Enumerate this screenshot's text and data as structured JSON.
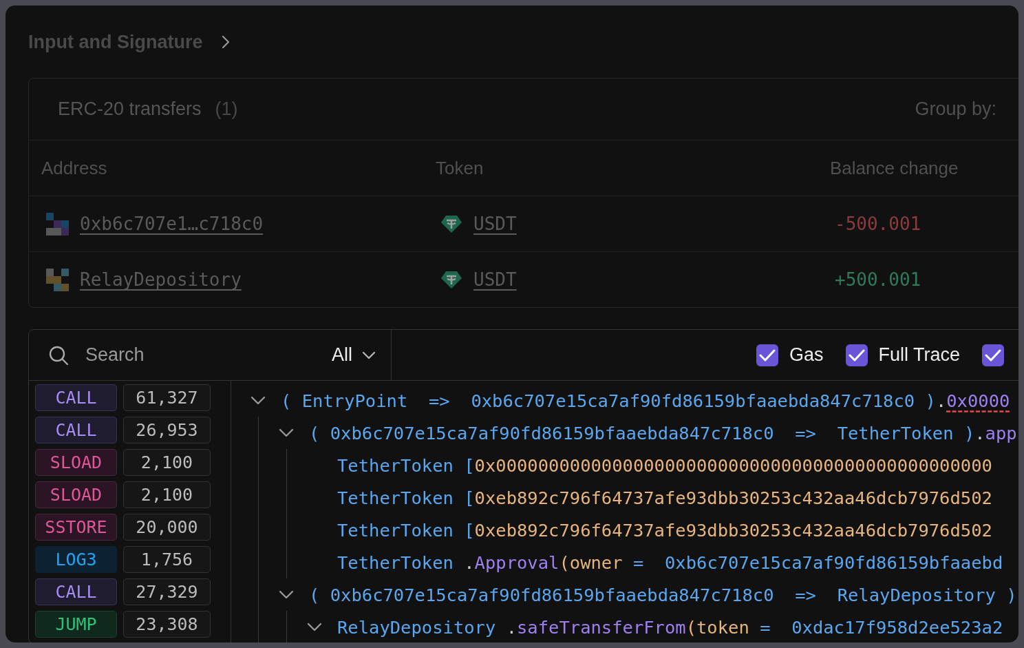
{
  "section_header": {
    "title": "Input and Signature"
  },
  "transfers": {
    "title": "ERC-20 transfers",
    "count": "(1)",
    "group_by_label": "Group by:",
    "columns": [
      "Address",
      "Token",
      "Balance change"
    ],
    "rows": [
      {
        "address": "0xb6c707e1…c718c0",
        "token": "USDT",
        "balance_change": "-500.001",
        "color": "#8c3a3c"
      },
      {
        "address": "RelayDepository",
        "token": "USDT",
        "balance_change": "+500.001",
        "color": "#2f7a58"
      }
    ]
  },
  "trace": {
    "search": {
      "placeholder": "Search"
    },
    "filter": "All",
    "toggles": [
      {
        "label": "Gas",
        "checked": true
      },
      {
        "label": "Full Trace",
        "checked": true
      },
      {
        "checked": true
      }
    ],
    "gas_rows": [
      {
        "op": "CALL",
        "kind": "call",
        "gas": "61,327"
      },
      {
        "op": "CALL",
        "kind": "call",
        "gas": "26,953"
      },
      {
        "op": "SLOAD",
        "kind": "storage",
        "gas": "2,100"
      },
      {
        "op": "SLOAD",
        "kind": "storage",
        "gas": "2,100"
      },
      {
        "op": "SSTORE",
        "kind": "storage",
        "gas": "20,000"
      },
      {
        "op": "LOG3",
        "kind": "log",
        "gas": "1,756"
      },
      {
        "op": "CALL",
        "kind": "call",
        "gas": "27,329"
      },
      {
        "op": "JUMP",
        "kind": "jump",
        "gas": "23,308"
      }
    ],
    "calls": [
      {
        "expanded": true,
        "tokens": [
          {
            "kind": "punct",
            "text": "( "
          },
          {
            "kind": "name",
            "text": "EntryPoint"
          },
          {
            "kind": "punct",
            "text": "  =>  "
          },
          {
            "kind": "name",
            "text": "0xb6c707e15ca7af90fd86159bfaaebda847c718c0"
          },
          {
            "kind": "punct",
            "text": " )"
          },
          {
            "kind": "dot",
            "text": "."
          },
          {
            "kind": "selector",
            "text": "0x0000"
          }
        ],
        "children": [
          {
            "expanded": true,
            "tokens": [
              {
                "kind": "punct",
                "text": "( "
              },
              {
                "kind": "name",
                "text": "0xb6c707e15ca7af90fd86159bfaaebda847c718c0"
              },
              {
                "kind": "punct",
                "text": "  =>  "
              },
              {
                "kind": "name",
                "text": "TetherToken"
              },
              {
                "kind": "punct",
                "text": " )"
              },
              {
                "kind": "dot",
                "text": "."
              },
              {
                "kind": "method",
                "text": "app"
              }
            ],
            "children": [
              {
                "tokens": [
                  {
                    "kind": "name",
                    "text": "TetherToken"
                  },
                  {
                    "kind": "punct",
                    "text": " ["
                  },
                  {
                    "kind": "arg",
                    "text": "0x00000000000000000000000000000000000000000000000"
                  }
                ]
              },
              {
                "tokens": [
                  {
                    "kind": "name",
                    "text": "TetherToken"
                  },
                  {
                    "kind": "punct",
                    "text": " ["
                  },
                  {
                    "kind": "arg",
                    "text": "0xeb892c796f64737afe93dbb30253c432aa46dcb7976d502"
                  }
                ]
              },
              {
                "tokens": [
                  {
                    "kind": "name",
                    "text": "TetherToken"
                  },
                  {
                    "kind": "punct",
                    "text": " ["
                  },
                  {
                    "kind": "arg",
                    "text": "0xeb892c796f64737afe93dbb30253c432aa46dcb7976d502"
                  }
                ]
              },
              {
                "tokens": [
                  {
                    "kind": "name",
                    "text": "TetherToken"
                  },
                  {
                    "kind": "dot",
                    "text": " ."
                  },
                  {
                    "kind": "method",
                    "text": "Approval"
                  },
                  {
                    "kind": "arg",
                    "text": "(owner"
                  },
                  {
                    "kind": "punct",
                    "text": " =  "
                  },
                  {
                    "kind": "name",
                    "text": "0xb6c707e15ca7af90fd86159bfaaebd"
                  }
                ]
              }
            ]
          },
          {
            "expanded": true,
            "tokens": [
              {
                "kind": "punct",
                "text": "( "
              },
              {
                "kind": "name",
                "text": "0xb6c707e15ca7af90fd86159bfaaebda847c718c0"
              },
              {
                "kind": "punct",
                "text": "  =>  "
              },
              {
                "kind": "name",
                "text": "RelayDepository"
              },
              {
                "kind": "punct",
                "text": " )"
              }
            ],
            "children": [
              {
                "expanded": true,
                "tokens": [
                  {
                    "kind": "name",
                    "text": "RelayDepository"
                  },
                  {
                    "kind": "dot",
                    "text": " ."
                  },
                  {
                    "kind": "method",
                    "text": "safeTransferFrom"
                  },
                  {
                    "kind": "arg",
                    "text": "(token"
                  },
                  {
                    "kind": "punct",
                    "text": " =  "
                  },
                  {
                    "kind": "name",
                    "text": "0xdac17f958d2ee523a2"
                  }
                ]
              }
            ]
          }
        ]
      }
    ]
  }
}
